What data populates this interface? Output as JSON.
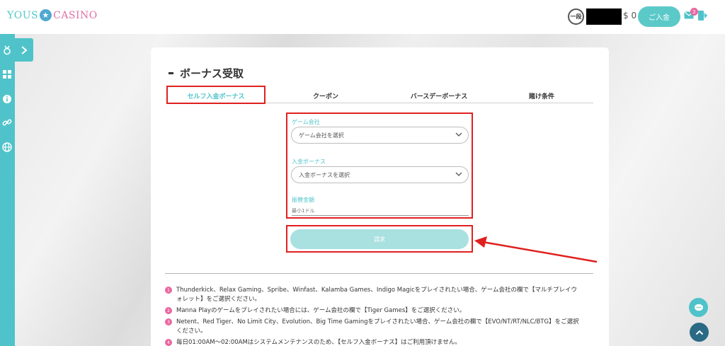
{
  "header": {
    "logo_left": "YOUS",
    "logo_star": "★",
    "logo_right": "CASINO",
    "rank_label": "一段",
    "balance": "$ 0",
    "deposit_label": "ご入金",
    "mail_count": "2"
  },
  "card": {
    "title": "ボーナス受取",
    "tabs": [
      {
        "label": "セルフ入金ボーナス"
      },
      {
        "label": "クーポン"
      },
      {
        "label": "バースデーボーナス"
      },
      {
        "label": "賭け条件"
      }
    ],
    "form": {
      "game_provider_label": "ゲーム会社",
      "game_provider_placeholder": "ゲーム会社を選択",
      "deposit_bonus_label": "入金ボーナス",
      "deposit_bonus_placeholder": "入金ボーナスを選択",
      "amount_label": "振替金額",
      "amount_placeholder": "最小1ドル",
      "submit_label": "請求"
    },
    "notes": [
      {
        "num": "1",
        "text": "Thunderkick、Relax Gaming、Spribe、Winfast、Kalamba Games、Indigo Magicをプレイされたい場合、ゲーム会社の欄で【マルチプレイウォレット】をご選択ください。"
      },
      {
        "num": "2",
        "text": "Manna Playのゲームをプレイされたい場合には、ゲーム会社の欄で【Tiger Games】をご選択ください。"
      },
      {
        "num": "3",
        "text": "Netent、Red Tiger、No Limit City、Evolution、Big Time Gamingをプレイされたい場合、ゲーム会社の欄で【EVO/NT/RT/NLC/BTG】をご選択ください。"
      },
      {
        "num": "4",
        "text": "毎日01:00AM～02:00AMはシステムメンテナンスのため、【セルフ入金ボーナス】はご利用頂けません。"
      }
    ]
  },
  "colors": {
    "accent": "#4fc3c9",
    "highlight": "#e02020",
    "badge": "#e9669f"
  }
}
